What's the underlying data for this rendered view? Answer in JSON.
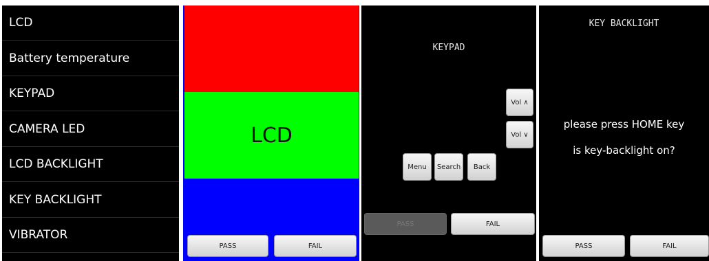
{
  "test_list": {
    "items": [
      "LCD",
      "Battery temperature",
      "KEYPAD",
      "CAMERA LED",
      "LCD BACKLIGHT",
      "KEY BACKLIGHT",
      "VIBRATOR"
    ]
  },
  "lcd_test": {
    "label": "LCD",
    "colors": [
      "#ff0000",
      "#00ff00",
      "#0000ff"
    ],
    "pass_label": "PASS",
    "fail_label": "FAIL"
  },
  "keypad_test": {
    "title": "KEYPAD",
    "vol_up_label": "Vol ∧",
    "vol_down_label": "Vol ∨",
    "menu_label": "Menu",
    "search_label": "Search",
    "back_label": "Back",
    "pass_label": "PASS",
    "fail_label": "FAIL"
  },
  "key_backlight_test": {
    "title": "KEY BACKLIGHT",
    "instruction": "please press HOME key",
    "question": "is key-backlight on?",
    "pass_label": "PASS",
    "fail_label": "FAIL"
  }
}
